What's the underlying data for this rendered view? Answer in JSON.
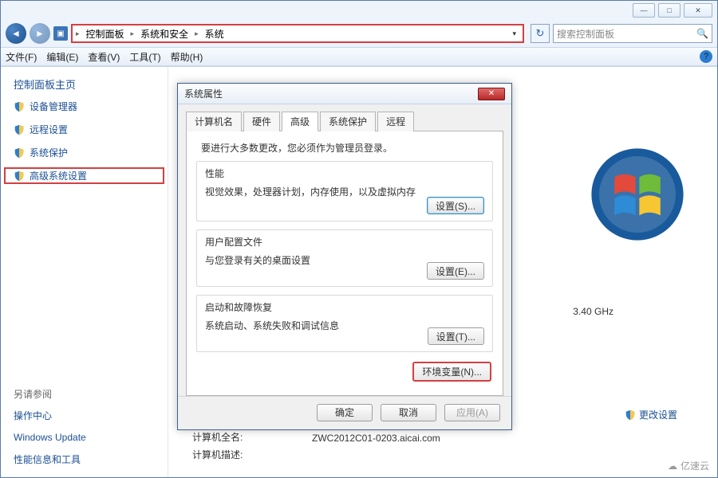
{
  "window_controls": {
    "min": "—",
    "max": "□",
    "close": "✕"
  },
  "breadcrumb": {
    "items": [
      "控制面板",
      "系统和安全",
      "系统"
    ]
  },
  "search": {
    "placeholder": "搜索控制面板"
  },
  "menubar": {
    "file": "文件(F)",
    "edit": "编辑(E)",
    "view": "查看(V)",
    "tools": "工具(T)",
    "help": "帮助(H)"
  },
  "sidebar": {
    "home": "控制面板主页",
    "items": [
      "设备管理器",
      "远程设置",
      "系统保护",
      "高级系统设置"
    ],
    "see_also_title": "另请参阅",
    "see_also": [
      "操作中心",
      "Windows Update",
      "性能信息和工具"
    ]
  },
  "content": {
    "ghz": "3.40 GHz",
    "change_settings": "更改设置",
    "full_name_label": "计算机全名:",
    "full_name_value": "ZWC2012C01-0203.aicai.com",
    "desc_label": "计算机描述:",
    "brand": "亿速云"
  },
  "dialog": {
    "title": "系统属性",
    "tabs": [
      "计算机名",
      "硬件",
      "高级",
      "系统保护",
      "远程"
    ],
    "active_tab": 2,
    "admin_note": "要进行大多数更改，您必须作为管理员登录。",
    "groups": {
      "perf": {
        "title": "性能",
        "desc": "视觉效果，处理器计划，内存使用，以及虚拟内存",
        "btn": "设置(S)..."
      },
      "profile": {
        "title": "用户配置文件",
        "desc": "与您登录有关的桌面设置",
        "btn": "设置(E)..."
      },
      "startup": {
        "title": "启动和故障恢复",
        "desc": "系统启动、系统失败和调试信息",
        "btn": "设置(T)..."
      }
    },
    "env_btn": "环境变量(N)...",
    "actions": {
      "ok": "确定",
      "cancel": "取消",
      "apply": "应用(A)"
    }
  }
}
